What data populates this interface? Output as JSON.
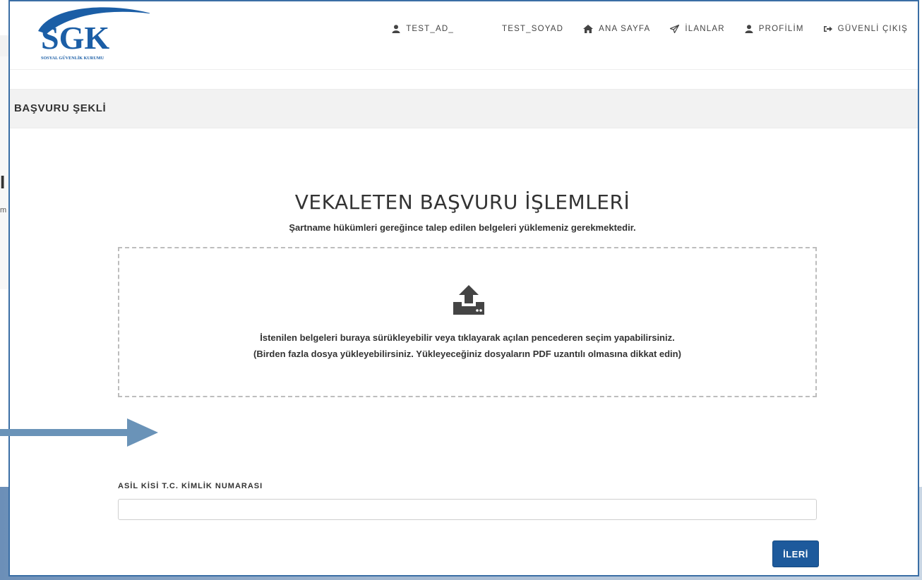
{
  "background": {
    "partial_heading": "I",
    "partial_text": "m"
  },
  "logo": {
    "text": "SGK",
    "subtext": "SOSYAL GÜVENLİK KURUMU",
    "brand_color": "#1b5ea6"
  },
  "nav": {
    "user_first": "TEST_AD_",
    "user_last": "TEST_SOYAD",
    "home": "ANA SAYFA",
    "listings": "İLANLAR",
    "profile": "PROFİLİM",
    "logout": "GÜVENLİ ÇIKIŞ"
  },
  "section": {
    "title": "BAŞVURU ŞEKLİ"
  },
  "main": {
    "title": "VEKALETEN BAŞVURU İŞLEMLERİ",
    "subtitle": "Şartname hükümleri gereğince talep edilen belgeleri yüklemeniz gerekmektedir."
  },
  "dropzone": {
    "icon": "upload-icon",
    "line1": "İstenilen belgeleri buraya sürükleyebilir veya tıklayarak açılan pencederen seçim yapabilirsiniz.",
    "line2": "(Birden fazla dosya yükleyebilirsiniz. Yükleyeceğiniz dosyaların PDF uzantılı olmasına dikkat edin)"
  },
  "form": {
    "tc_label": "ASİL KİSİ T.C. KİMLİK NUMARASI",
    "tc_value": "",
    "next_label": "İLERİ"
  },
  "colors": {
    "accent": "#1d5a9c",
    "frame": "#3a6ea5",
    "annotation_arrow": "#6a93b8"
  }
}
